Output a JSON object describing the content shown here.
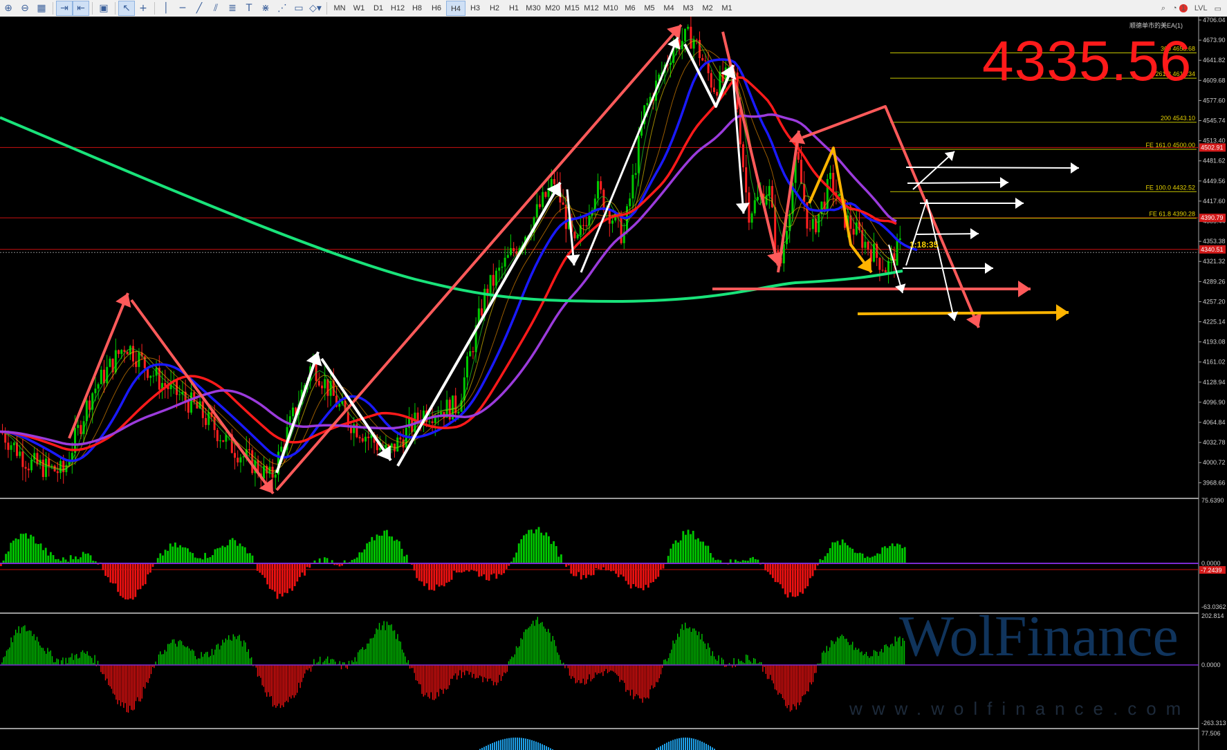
{
  "toolbar": {
    "tools": [
      "zoom-in-icon",
      "zoom-out-icon",
      "grid-icon",
      "autoscroll-icon",
      "chart-shift-icon",
      "screenshot-icon",
      "cursor-icon",
      "crosshair-icon",
      "vertical-line-icon",
      "horizontal-line-icon",
      "trend-line-icon",
      "channel-icon",
      "fibonacci-icon",
      "text-icon",
      "gann-icon",
      "pitchfork-icon",
      "rectangle-icon",
      "shapes-icon"
    ],
    "timeframes": [
      "MN",
      "W1",
      "D1",
      "H12",
      "H8",
      "H6",
      "H4",
      "H3",
      "H2",
      "H1",
      "M30",
      "M20",
      "M15",
      "M12",
      "M10",
      "M6",
      "M5",
      "M4",
      "M3",
      "M2",
      "M1"
    ],
    "active_timeframe": "H4",
    "notification_count": "1",
    "lvl_label": "LVL"
  },
  "indicator_title": "顺德单市的美EA(1)",
  "current_price_big": "4335.56",
  "countdown": "1:18:35",
  "price_axis": [
    "4706.04",
    "4673.90",
    "4641.82",
    "4609.68",
    "4577.60",
    "4545.74",
    "4513.40",
    "4481.62",
    "4449.56",
    "4417.60",
    "4385.44",
    "4353.38",
    "4321.32",
    "4289.26",
    "4257.20",
    "4225.14",
    "4193.08",
    "4161.02",
    "4128.94",
    "4096.90",
    "4064.84",
    "4032.78",
    "4000.72",
    "3968.66"
  ],
  "price_tags": {
    "fe161": "4502.91",
    "fe61": "4390.79",
    "current": "4340.51",
    "current2": "4335.56"
  },
  "fib_levels": [
    {
      "label": "300",
      "value": "4653.68"
    },
    {
      "label": "261.8",
      "value": "4613.34"
    },
    {
      "label": "200",
      "value": "4543.10"
    },
    {
      "label": "FE 161.0",
      "value": "4500.00"
    },
    {
      "label": "FE 100.0",
      "value": "4432.52"
    },
    {
      "label": "FE 61.8",
      "value": "4390.28"
    }
  ],
  "osc1_axis": {
    "top": "75.6390",
    "zero": "0.0000",
    "bottom": "-63.0362",
    "tag": "-7.2439"
  },
  "osc2_axis": {
    "top": "202.814",
    "zero": "0.0000",
    "bottom": "-263.313"
  },
  "osc3_axis": {
    "top": "77.506"
  },
  "watermark": {
    "brand": "WolFinance",
    "url": "www.wolfinance.com"
  },
  "colors": {
    "bull": "#00c800",
    "bear": "#ff2020",
    "ma_blue": "#1a1aff",
    "ma_red": "#ff1a1a",
    "ma_purple": "#9b3bdc",
    "ma_green": "#19e37a",
    "arrow_red": "#ff5a5a",
    "arrow_yellow": "#ffb400",
    "fib_line": "#c8c800"
  }
}
